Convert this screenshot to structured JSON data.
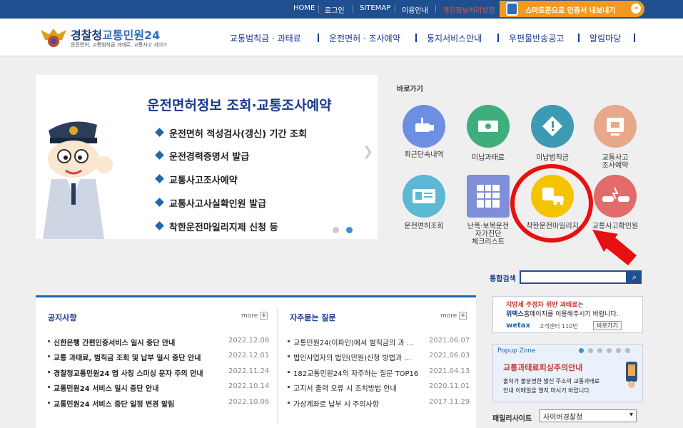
{
  "topbar": {
    "links": [
      "HOME",
      "로그인",
      "SITEMAP",
      "이용안내",
      "개인정보처리방침"
    ],
    "phone_button": "스마트폰으로 인증서 내보내기"
  },
  "header": {
    "logo_main_a": "경찰청",
    "logo_main_b": "교통민원24",
    "logo_sub": "운전면허, 교통범칙금 과태료, 교통사고 서비스",
    "nav": [
      "교통범칙금 · 과태료",
      "운전면허 · 조사예약",
      "통지서비스안내",
      "우편물반송공고",
      "알림마당"
    ]
  },
  "banner": {
    "title": "운전면허정보 조회·교통조사예약",
    "items": [
      "운전면허 적성검사(갱신) 기간 조회",
      "운전경력증명서 발급",
      "교통사고조사예약",
      "교통사고사실확인원 발급",
      "착한운전마일리지제 신청 등"
    ]
  },
  "quick": {
    "title": "바로가기",
    "items": [
      {
        "label": "최근단속내역",
        "icon": "camera-icon",
        "color": "#6c8fe2"
      },
      {
        "label": "미납과태료",
        "icon": "money-icon",
        "color": "#3fae7c"
      },
      {
        "label": "미납범칙금",
        "icon": "warning-icon",
        "color": "#3d9ab3"
      },
      {
        "label": "교통사고\n조사예약",
        "icon": "monitor-icon",
        "color": "#e8a88a"
      },
      {
        "label": "운전면허조회",
        "icon": "license-icon",
        "color": "#5db8d4"
      },
      {
        "label": "난폭·보복운전\n자가진단\n체크리스트",
        "icon": "checklist-icon",
        "color": "#7f8fd9"
      },
      {
        "label": "착한운전마일리지",
        "icon": "mileage-icon",
        "color": "#f5c400"
      },
      {
        "label": "교통사고확인원",
        "icon": "car-crash-icon",
        "color": "#e26b6b"
      }
    ]
  },
  "search": {
    "label": "통합검색",
    "value": ""
  },
  "notices": {
    "title": "공지사항",
    "more": "more",
    "rows": [
      {
        "text": "신한은행 간편인증서비스 일시 중단 안내",
        "date": "2022.12.08"
      },
      {
        "text": "교통 과태료, 범칙금 조회 및 납부 일시 중단 안내",
        "date": "2022.12.01"
      },
      {
        "text": "경찰청교통민원24 앱 사칭 스미싱 문자 주의 안내",
        "date": "2022.11.24"
      },
      {
        "text": "교통민원24 서비스 일시 중단 안내",
        "date": "2022.10.14"
      },
      {
        "text": "교통민원24 서비스 중단 일정 변경 알림",
        "date": "2022.10.06"
      }
    ]
  },
  "faq": {
    "title": "자주묻는 질문",
    "more": "more",
    "rows": [
      {
        "text": "교통민원24(이파인)에서 범칙금의 과 ...",
        "date": "2021.06.07"
      },
      {
        "text": "법인사업자의 법인(민원)신청 방법과 ...",
        "date": "2021.06.03"
      },
      {
        "text": "182교통민원24의 자주하는 질문 TOP16",
        "date": "2021.04.13"
      },
      {
        "text": "고지서 출력 오류 시 조치방법 안내",
        "date": "2020.11.01"
      },
      {
        "text": "가상계좌로 납부 시 주의사항",
        "date": "2017.11.29"
      }
    ]
  },
  "wetax": {
    "line1_a": "지방세 주정차 위반 과태료",
    "line1_b": "는",
    "line2_a": "위택스",
    "line2_b": "홈페이지를 이용해주시기 바랍니다.",
    "brand": "wetax",
    "center": "고객센터 110번",
    "button": "바로가기"
  },
  "popup": {
    "zone": "Popup Zone",
    "title": "교통과태료피싱주의안내",
    "desc1": "출처가 불분명한 발신 주소의 교통과태료",
    "desc2": "안내 이메일을 열지 마시기 바랍니다."
  },
  "family": {
    "label": "패밀리사이트",
    "selected": "사이버경찰청"
  },
  "annotation_color": "#e81010"
}
